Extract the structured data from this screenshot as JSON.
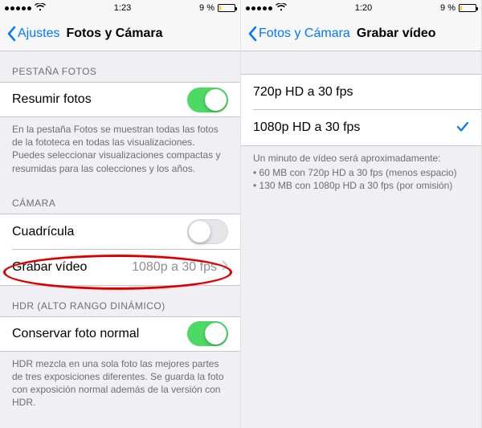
{
  "left": {
    "status": {
      "time": "1:23",
      "battery_pct": "9 %",
      "battery_fill": "12%",
      "signal_dots": 5,
      "carrier_hidden": true
    },
    "nav": {
      "back": "Ajustes",
      "title": "Fotos y Cámara"
    },
    "sections": {
      "fotos": {
        "header": "PESTAÑA FOTOS",
        "resumir_label": "Resumir fotos",
        "resumir_on": true,
        "footer": "En la pestaña Fotos se muestran todas las fotos de la fototeca en todas las visualizaciones. Puedes seleccionar visualizaciones compactas y resumidas para las colecciones y los años."
      },
      "camara": {
        "header": "CÁMARA",
        "cuadricula_label": "Cuadrícula",
        "cuadricula_on": false,
        "grabar_label": "Grabar vídeo",
        "grabar_value": "1080p a 30 fps"
      },
      "hdr": {
        "header": "HDR (ALTO RANGO DINÁMICO)",
        "conservar_label": "Conservar foto normal",
        "conservar_on": true,
        "footer": "HDR mezcla en una sola foto las mejores partes de tres exposiciones diferentes. Se guarda la foto con exposición normal además de la versión con HDR."
      }
    }
  },
  "right": {
    "status": {
      "time": "1:20",
      "battery_pct": "9 %",
      "battery_fill": "12%"
    },
    "nav": {
      "back": "Fotos y Cámara",
      "title": "Grabar vídeo"
    },
    "options": [
      {
        "label": "720p HD a 30 fps",
        "selected": false
      },
      {
        "label": "1080p HD a 30 fps",
        "selected": true
      }
    ],
    "footer_intro": "Un minuto de vídeo será aproximadamente:",
    "footer_items": [
      "60 MB con 720p HD a 30 fps (menos espacio)",
      "130 MB con 1080p HD a 30 fps (por omisión)"
    ]
  }
}
